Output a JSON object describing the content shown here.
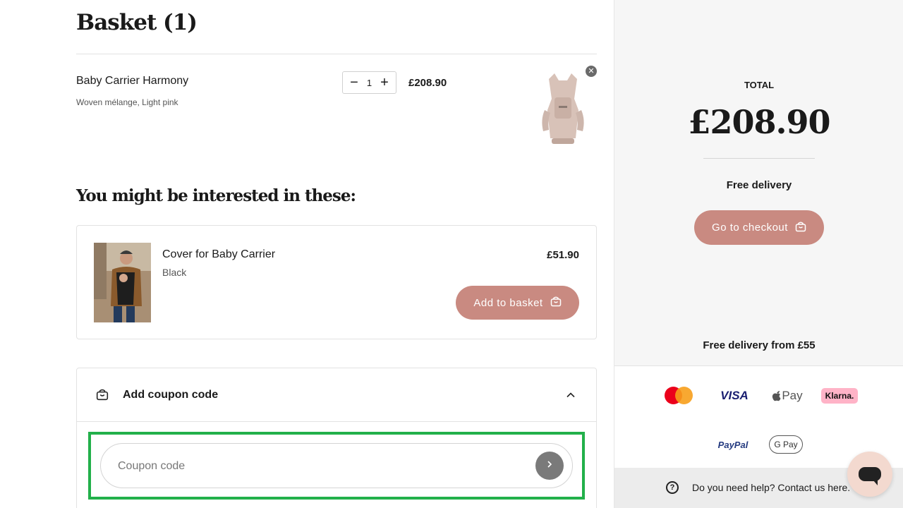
{
  "page": {
    "title": "Basket (1)"
  },
  "basket": {
    "items": [
      {
        "name": "Baby Carrier Harmony",
        "variant": "Woven mélange, Light pink",
        "quantity": "1",
        "price": "£208.90",
        "decrease_symbol": "−",
        "increase_symbol": "+",
        "remove_symbol": "✕"
      }
    ]
  },
  "recommendations": {
    "title": "You might be interested in these:",
    "items": [
      {
        "name": "Cover for Baby Carrier",
        "variant": "Black",
        "price": "£51.90",
        "button_label": "Add to basket"
      }
    ]
  },
  "coupon": {
    "header_label": "Add coupon code",
    "placeholder": "Coupon code",
    "value": ""
  },
  "summary": {
    "total_label": "TOTAL",
    "total_value": "£208.90",
    "delivery": "Free delivery",
    "checkout_label": "Go to checkout",
    "free_delivery_from": "Free delivery from £55"
  },
  "payments": {
    "visa": "VISA",
    "apple_pay": "Pay",
    "klarna": "Klarna.",
    "paypal": "PayPal",
    "google_pay": "G Pay"
  },
  "help": {
    "icon_glyph": "?",
    "text": "Do you need help? Contact us here."
  },
  "colors": {
    "accent": "#c98a81",
    "highlight": "#22b04a",
    "sidebar_bg": "#f6f6f6"
  },
  "icons": [
    "basket-icon",
    "close-icon",
    "chevron-up-icon",
    "arrow-right-icon",
    "help-icon",
    "chat-icon"
  ]
}
